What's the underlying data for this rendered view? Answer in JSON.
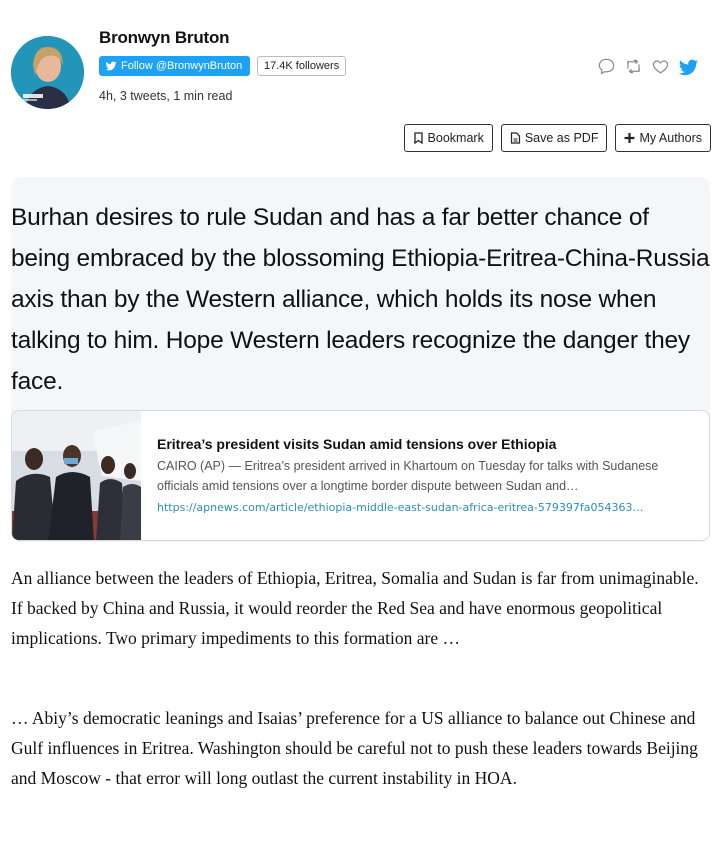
{
  "author": {
    "name": "Bronwyn Bruton",
    "follow_label": "Follow @BronwynBruton",
    "followers": "17.4K followers",
    "meta": "4h, 3 tweets, 1 min read"
  },
  "icons": {
    "reply": "speech-bubble-icon",
    "retweet": "retweet-icon",
    "like": "heart-icon",
    "twitter": "twitter-bird-icon"
  },
  "toolbar": {
    "bookmark": "Bookmark",
    "save_pdf": "Save as PDF",
    "my_authors": "My Authors"
  },
  "tweet": {
    "text": "Burhan desires to rule Sudan and has a far better chance of being embraced by the blossoming Ethiopia-Eritrea-China-Russia axis than by the Western alliance, which holds its nose when talking to him. Hope Western leaders recognize the danger they face."
  },
  "card": {
    "title": "Eritrea’s president visits Sudan amid tensions over Ethiopia",
    "description": "CAIRO (AP) — Eritrea’s president arrived in Khartoum on Tuesday for talks with Sudanese officials amid tensions over a longtime border dispute between Sudan and…",
    "link": "https://apnews.com/article/ethiopia-middle-east-sudan-africa-eritrea-579397fa054363…"
  },
  "paragraphs": [
    "An alliance between the leaders of Ethiopia, Eritrea, Somalia and Sudan is far from unimaginable. If backed by China and Russia, it would reorder the Red Sea and have enormous geopolitical implications. Two primary impediments to this formation are …",
    "… Abiy’s democratic leanings and Isaias’ preference for a US alliance to balance out Chinese and Gulf influences in Eritrea. Washington should be careful not to push these leaders towards Beijing and Moscow - that error will long outlast the current instability in HOA."
  ],
  "colors": {
    "twitter_blue": "#1da1f2",
    "avatar_ring": "#1fa9c9",
    "tweet_bg": "#f3f7fa",
    "link": "#2a8ebd"
  }
}
